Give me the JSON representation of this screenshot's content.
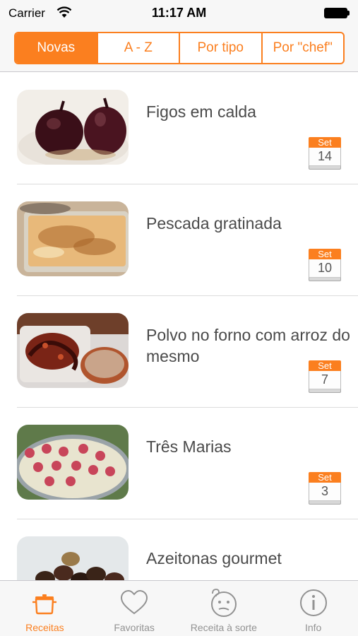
{
  "status_bar": {
    "carrier": "Carrier",
    "time": "11:17 AM"
  },
  "segments": [
    {
      "label": "Novas",
      "selected": true
    },
    {
      "label": "A - Z",
      "selected": false
    },
    {
      "label": "Por tipo",
      "selected": false
    },
    {
      "label": "Por \"chef\"",
      "selected": false
    }
  ],
  "recipes": [
    {
      "title": "Figos em calda",
      "month": "Set",
      "day": "14"
    },
    {
      "title": "Pescada gratinada",
      "month": "Set",
      "day": "10"
    },
    {
      "title": "Polvo no forno com arroz do mesmo",
      "month": "Set",
      "day": "7"
    },
    {
      "title": "Três Marias",
      "month": "Set",
      "day": "3"
    },
    {
      "title": "Azeitonas gourmet",
      "month": "",
      "day": ""
    }
  ],
  "tabs": [
    {
      "label": "Receitas",
      "icon": "pot-icon",
      "active": true
    },
    {
      "label": "Favoritas",
      "icon": "heart-icon",
      "active": false
    },
    {
      "label": "Receita à sorte",
      "icon": "thinking-face-icon",
      "active": false
    },
    {
      "label": "Info",
      "icon": "info-icon",
      "active": false
    }
  ],
  "colors": {
    "accent": "#fb7f1f",
    "inactive_tab": "#929292",
    "title_text": "#4a4a4a"
  }
}
